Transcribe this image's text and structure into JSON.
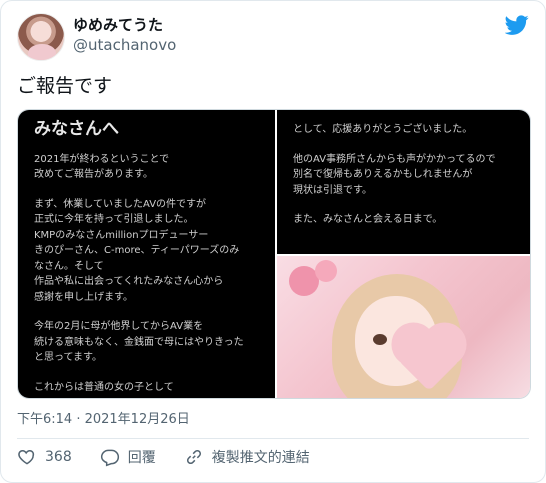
{
  "user": {
    "display_name": "ゆめみてうた",
    "handle": "@utachanovo",
    "avatar_icon": "profile-photo"
  },
  "tweet": {
    "text": "ご報告です",
    "timestamp": "下午6:14 · 2021年12月26日"
  },
  "media": {
    "left_image": {
      "heading": "みなさんへ",
      "paragraphs": [
        [
          "2021年が終わるということで",
          "改めてご報告があります。"
        ],
        [
          "まず、休業していましたAVの件ですが",
          "正式に今年を持って引退しました。",
          "KMPのみなさんmillionプロデューサー",
          "きのぴーさん、C-more、ティーパワーズのみ",
          "なさん。そして",
          "作品や私に出会ってくれたみなさん心から",
          "感謝を申し上げます。"
        ],
        [
          "今年の2月に母が他界してからAV業を",
          "続ける意味もなく、金銭面で母にはやりきった",
          "と思ってます。"
        ],
        [
          "これからは普通の女の子として"
        ]
      ]
    },
    "right_image": {
      "paragraphs": [
        [
          "として、応援ありがとうございました。"
        ],
        [
          "他のAV事務所さんからも声がかかってるので",
          "別名で復帰もありえるかもしれませんが",
          "現状は引退です。"
        ],
        [
          "また、みなさんと会える日まで。"
        ]
      ]
    },
    "photo": "girl-with-heart-photo"
  },
  "actions": {
    "like_count": "368",
    "reply_label": "回覆",
    "copy_link_label": "複製推文的連結"
  },
  "colors": {
    "brand": "#1d9bf0",
    "text_secondary": "#536471",
    "border": "#e1e8ed"
  }
}
